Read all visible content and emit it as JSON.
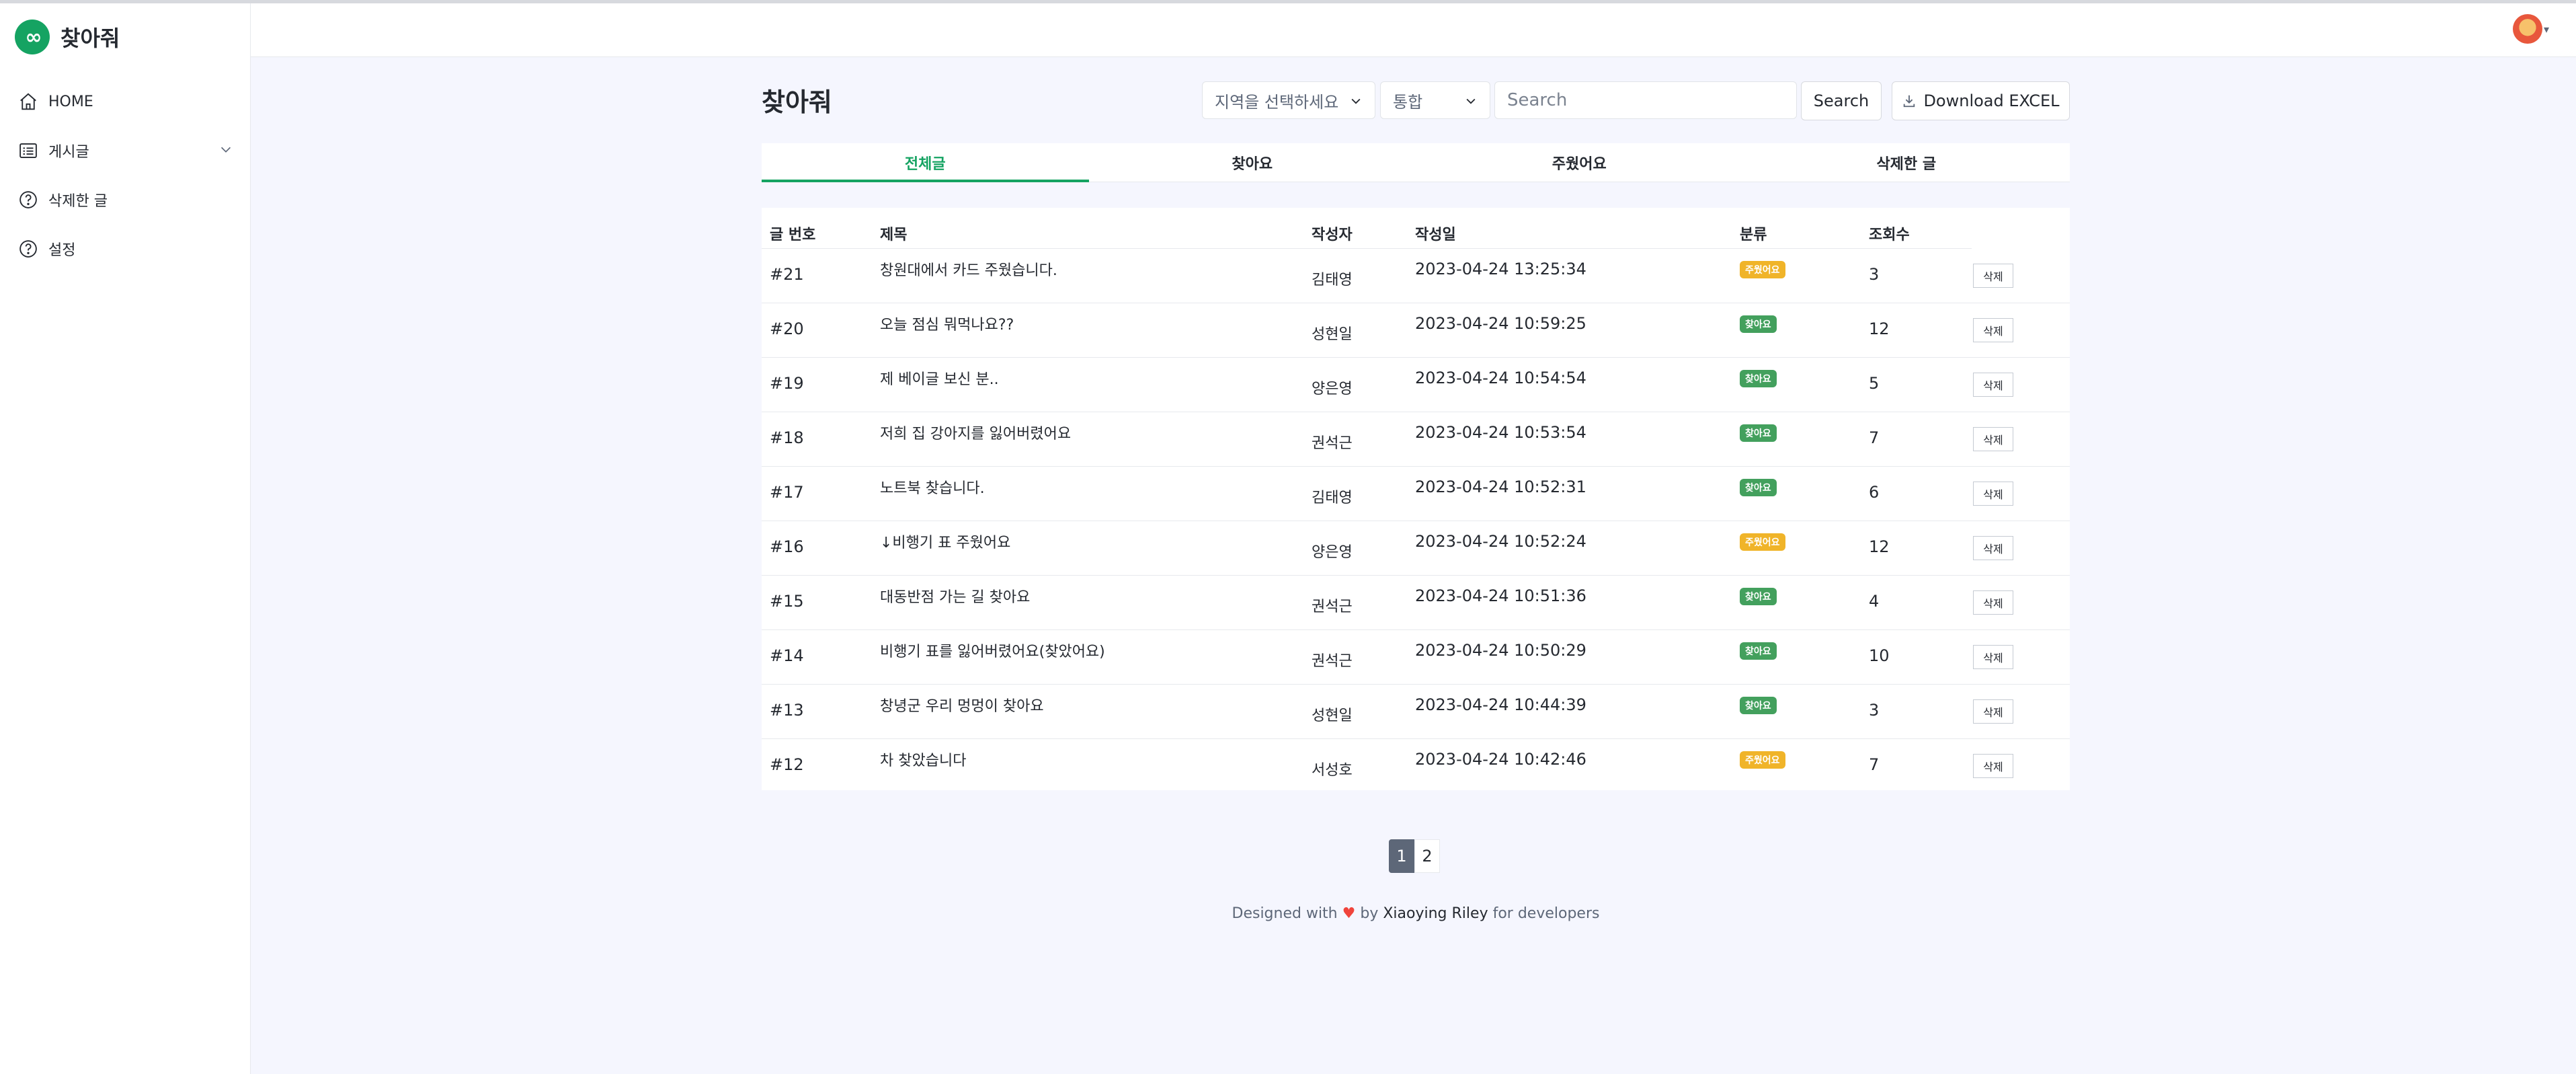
{
  "app": {
    "name": "찾아줘",
    "logo_text": "∞"
  },
  "sidebar": {
    "items": [
      {
        "label": "HOME",
        "icon": "home-icon"
      },
      {
        "label": "게시글",
        "icon": "list-icon"
      },
      {
        "label": "삭제한 글",
        "icon": "help-circle-icon"
      },
      {
        "label": "설정",
        "icon": "help-circle-icon"
      }
    ]
  },
  "page": {
    "title": "찾아줘"
  },
  "filters": {
    "region_select": "지역을 선택하세요",
    "type_select": "통합",
    "search_placeholder": "Search",
    "search_button": "Search",
    "download_button": "Download EXCEL"
  },
  "tabs": [
    {
      "label": "전체글",
      "active": true
    },
    {
      "label": "찾아요",
      "active": false
    },
    {
      "label": "주웠어요",
      "active": false
    },
    {
      "label": "삭제한 글",
      "active": false
    }
  ],
  "table": {
    "headers": [
      "글 번호",
      "제목",
      "작성자",
      "작성일",
      "분류",
      "조회수"
    ],
    "delete_label": "삭제",
    "rows": [
      {
        "num": "#21",
        "title": "창원대에서 카드 주웠습니다.",
        "author": "김태영",
        "date": "2023-04-24 13:25:34",
        "category": "주웠어요",
        "cat_color": "#f0b429",
        "views": "3"
      },
      {
        "num": "#20",
        "title": "오늘 점심 뭐먹나요??",
        "author": "성현일",
        "date": "2023-04-24 10:59:25",
        "category": "찾아요",
        "cat_color": "#43a05d",
        "views": "12"
      },
      {
        "num": "#19",
        "title": "제 베이글 보신 분..",
        "author": "양은영",
        "date": "2023-04-24 10:54:54",
        "category": "찾아요",
        "cat_color": "#43a05d",
        "views": "5"
      },
      {
        "num": "#18",
        "title": "저희 집 강아지를 잃어버렸어요",
        "author": "권석근",
        "date": "2023-04-24 10:53:54",
        "category": "찾아요",
        "cat_color": "#43a05d",
        "views": "7"
      },
      {
        "num": "#17",
        "title": "노트북 찾습니다.",
        "author": "김태영",
        "date": "2023-04-24 10:52:31",
        "category": "찾아요",
        "cat_color": "#43a05d",
        "views": "6"
      },
      {
        "num": "#16",
        "title": "↓비행기 표 주웠어요",
        "author": "양은영",
        "date": "2023-04-24 10:52:24",
        "category": "주웠어요",
        "cat_color": "#f0b429",
        "views": "12"
      },
      {
        "num": "#15",
        "title": "대동반점 가는 길 찾아요",
        "author": "권석근",
        "date": "2023-04-24 10:51:36",
        "category": "찾아요",
        "cat_color": "#43a05d",
        "views": "4"
      },
      {
        "num": "#14",
        "title": "비행기 표를 잃어버렸어요(찾았어요)",
        "author": "권석근",
        "date": "2023-04-24 10:50:29",
        "category": "찾아요",
        "cat_color": "#43a05d",
        "views": "10"
      },
      {
        "num": "#13",
        "title": "창녕군 우리 멍멍이 찾아요",
        "author": "성현일",
        "date": "2023-04-24 10:44:39",
        "category": "찾아요",
        "cat_color": "#43a05d",
        "views": "3"
      },
      {
        "num": "#12",
        "title": "차 찾았습니다",
        "author": "서성호",
        "date": "2023-04-24 10:42:46",
        "category": "주웠어요",
        "cat_color": "#f0b429",
        "views": "7"
      }
    ]
  },
  "pagination": {
    "pages": [
      "1",
      "2"
    ],
    "current": "1"
  },
  "footer": {
    "prefix": "Designed with",
    "heart": "♥",
    "by": "by",
    "author": "Xiaoying Riley",
    "suffix": "for developers"
  },
  "colors": {
    "accent": "#15a362",
    "found": "#43a05d",
    "picked": "#f0b429",
    "background": "#f5f6fe"
  }
}
